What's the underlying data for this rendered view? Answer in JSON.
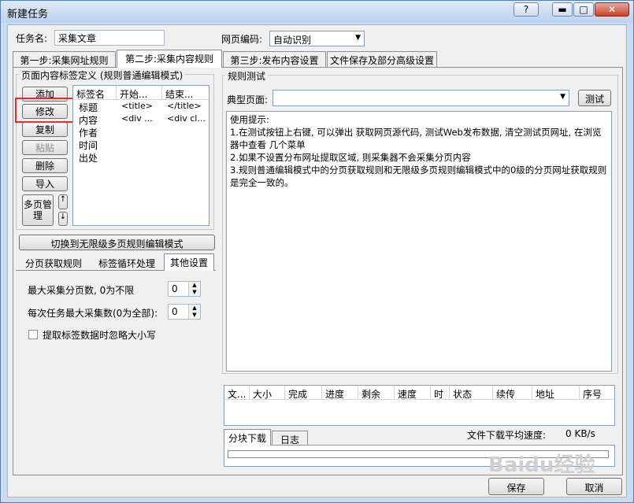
{
  "window": {
    "title": "新建任务",
    "help": "?",
    "minimize": "▬",
    "maximize": "□",
    "close": "✕"
  },
  "task": {
    "name_label": "任务名:",
    "name_value": "采集文章",
    "encoding_label": "网页编码:",
    "encoding_value": "自动识别"
  },
  "tabs": [
    "第一步:采集网址规则",
    "第二步:采集内容规则",
    "第三步:发布内容设置",
    "文件保存及部分高级设置"
  ],
  "tag_def": {
    "legend": "页面内容标签定义 (规则普通编辑模式)",
    "buttons": {
      "add": "添加",
      "edit": "修改",
      "copy": "复制",
      "paste": "粘贴",
      "delete": "删除",
      "import": "导入",
      "multipage": "多页管理",
      "up": "↑",
      "down": "↓"
    },
    "columns": [
      "标签名",
      "开始...",
      "结束..."
    ],
    "rows": [
      [
        "标题",
        "<title>",
        "</title>"
      ],
      [
        "内容",
        "<div ...",
        "<div cl..."
      ],
      [
        "作者",
        "",
        ""
      ],
      [
        "时间",
        "",
        ""
      ],
      [
        "出处",
        "",
        ""
      ]
    ]
  },
  "switch_button": "切换到无限级多页规则编辑模式",
  "subtabs": [
    "分页获取规则",
    "标签循环处理",
    "其他设置"
  ],
  "other": {
    "max_pages_label": "最大采集分页数, 0为不限",
    "max_pages_value": "0",
    "max_per_task_label": "每次任务最大采集数(0为全部):",
    "max_per_task_value": "0",
    "ignore_case_label": "提取标签数据时忽略大小写"
  },
  "rule_test": {
    "legend": "规则测试",
    "page_label": "典型页面:",
    "page_value": "",
    "test_button": "测试",
    "hints": [
      "使用提示:",
      "1.在测试按钮上右键, 可以弹出 获取网页源代码, 测试Web发布数据, 清空测试页网址, 在浏览器中查看 几个菜单",
      "2.如果不设置分布网址提取区域, 则采集器不会采集分页内容",
      "3.规则普通编辑模式中的分页获取规则和无限级多页规则编辑模式中的0级的分页网址获取规则是完全一致的。"
    ]
  },
  "downloads": {
    "columns": [
      "文...",
      "大小",
      "完成",
      "进度",
      "剩余",
      "速度",
      "时",
      "状态",
      "续传",
      "地址",
      "序号"
    ],
    "tabs": [
      "分块下载",
      "日志"
    ],
    "avg_speed_label": "文件下载平均速度:",
    "avg_speed_value": "0 KB/s"
  },
  "footer": {
    "save": "保存",
    "cancel": "取消"
  },
  "watermark": "Baidu经验"
}
